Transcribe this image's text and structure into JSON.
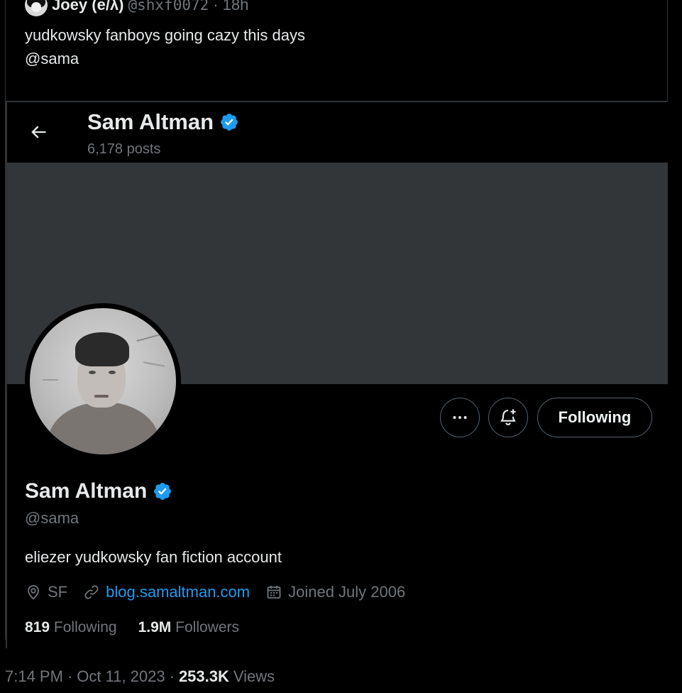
{
  "tweet": {
    "author_name": "Joey (e/λ)",
    "author_handle": "@shxf0072",
    "separator": "·",
    "time_ago": "18h",
    "text_line1": "yudkowsky fanboys going cazy this days",
    "text_line2": "@sama"
  },
  "embed": {
    "header_name": "Sam Altman",
    "posts_count": "6,178 posts",
    "profile_name": "Sam Altman",
    "handle": "@sama",
    "bio": "eliezer yudkowsky fan fiction account",
    "location": "SF",
    "website": "blog.samaltman.com",
    "joined": "Joined July 2006",
    "following_count": "819",
    "following_label": "Following",
    "followers_count": "1.9M",
    "followers_label": "Followers",
    "more_button": "···",
    "following_button": "Following"
  },
  "footer": {
    "time": "7:14 PM",
    "sep1": "·",
    "date": "Oct 11, 2023",
    "sep2": "·",
    "views_count": "253.3K",
    "views_label": "Views"
  },
  "colors": {
    "background": "#000000",
    "banner": "#333639",
    "text_primary": "#e7e9ea",
    "text_secondary": "#71767b",
    "link": "#1d9bf0",
    "verified": "#1d9bf0",
    "border": "#2f3336"
  },
  "icons": [
    "back-arrow-icon",
    "verified-badge-icon",
    "more-icon",
    "notification-bell-plus-icon",
    "location-icon",
    "link-icon",
    "calendar-icon"
  ]
}
